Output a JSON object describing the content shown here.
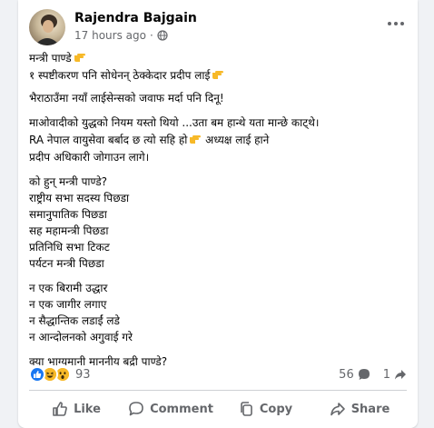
{
  "post": {
    "author": "Rajendra Bajgain",
    "time": "17 hours ago",
    "separator": "·",
    "visibility_icon": "globe-icon",
    "lines": {
      "l1": "मन्त्री पाण्डे",
      "l2": "१ स्पष्टीकरण पनि सोधेनन् ठेक्केदार प्रदीप लाई",
      "l3": "भैराठाउँमा नयाँ लाईसेन्सको जवाफ मर्दा पनि दिनू!",
      "l4": "माओवादीको युद्धको नियम यस्तो थियो ...उता बम हान्थे यता मान्छे काट्थे।",
      "l5": "RA नेपाल वायुसेवा बर्बाद छ त्यो सहि हो",
      "l5b": "अध्यक्ष लाई हाने",
      "l6": "प्रदीप अधिकारी जोगाउन लागे।",
      "l7": "को हुन् मन्त्री पाण्डे?",
      "l8": "राष्ट्रीय सभा सदस्य पिछडा",
      "l9": "समानुपातिक पिछडा",
      "l10": "सह महामन्त्री पिछडा",
      "l11": "प्रतिनिधि सभा टिकट",
      "l12": "पर्यटन मन्त्री पिछडा",
      "l13": "न एक बिरामी उद्धार",
      "l14": "न एक जागीर लगाए",
      "l15": "न सैद्धान्तिक लडाईं लडे",
      "l16": "न आन्दोलनको अगुवाई गरे",
      "l17": "क्या भाग्यमानी माननीय बद्री पाण्डे?"
    },
    "emoji": "backhand-index-pointing-right"
  },
  "stats": {
    "reaction_icons": [
      "like-reaction-icon",
      "haha-reaction-icon",
      "wow-reaction-icon"
    ],
    "reaction_count": "93",
    "comment_count": "56",
    "share_count": "1"
  },
  "actions": {
    "like": "Like",
    "comment": "Comment",
    "copy": "Copy",
    "share": "Share"
  },
  "colors": {
    "background": "#f0f2f5",
    "card": "#ffffff",
    "secondary_text": "#65676b",
    "like_blue": "#1877f2",
    "emoji_yellow": "#f7b928"
  }
}
